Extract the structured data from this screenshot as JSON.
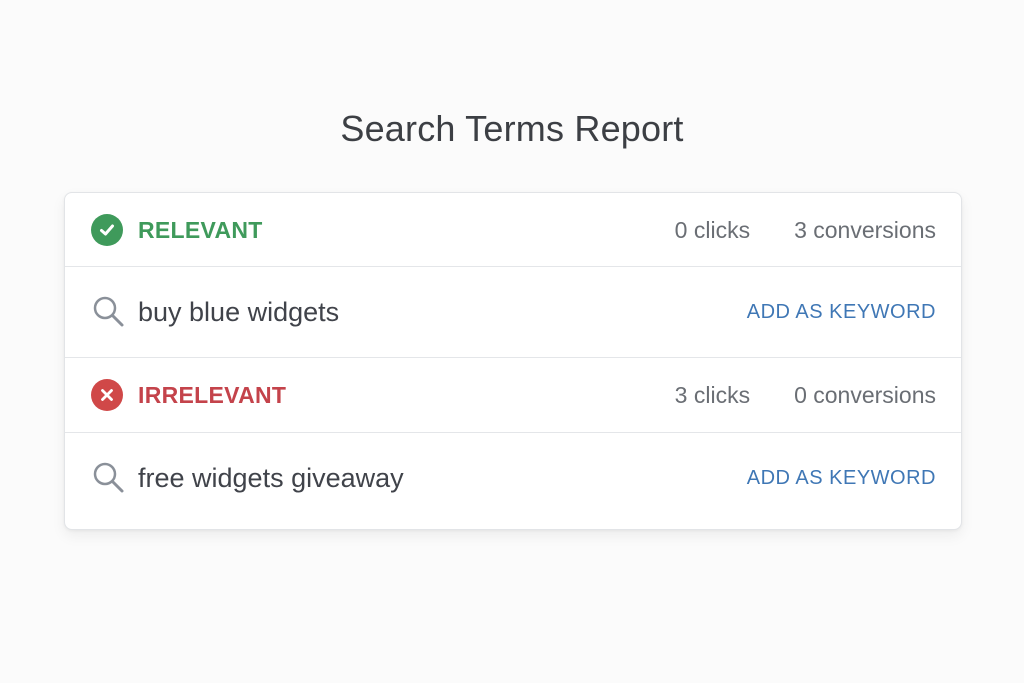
{
  "page": {
    "title": "Search Terms Report"
  },
  "groups": [
    {
      "status": "RELEVANT",
      "status_icon": "check-circle-icon",
      "status_color": "#3f9a5b",
      "clicks": "0 clicks",
      "conversions": "3 conversions",
      "term": "buy blue widgets",
      "term_icon": "search-icon",
      "action_label": "ADD AS KEYWORD"
    },
    {
      "status": "IRRELEVANT",
      "status_icon": "x-circle-icon",
      "status_color": "#c4434b",
      "clicks": "3 clicks",
      "conversions": "0 conversions",
      "term": "free widgets giveaway",
      "term_icon": "search-icon",
      "action_label": "ADD AS KEYWORD"
    }
  ],
  "colors": {
    "accent_link": "#3f77b5",
    "relevant": "#3f9a5b",
    "irrelevant": "#c4434b"
  }
}
